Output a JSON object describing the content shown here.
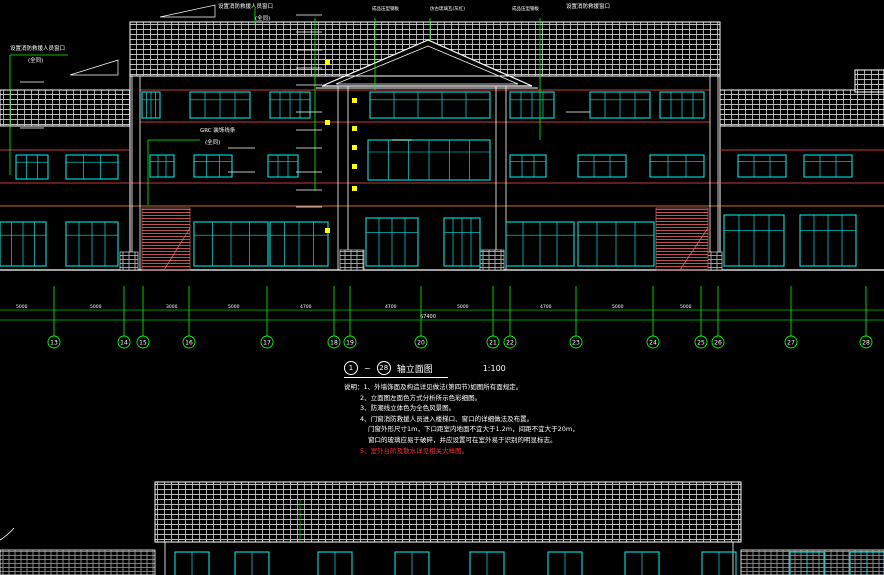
{
  "drawing": {
    "title_circle_from": "1",
    "title_circle_to": "28",
    "title_text": "轴立面图",
    "scale": "1:100",
    "notes": [
      "说明：1、外墙饰面及构造详见做法(第四节)如图所有面规定。",
      "2、立面图左面色方式分析所示色彩细图。",
      "3、防潮线立体色为全色风景图。",
      "4、门窗消防救援人员进入楼梯口、窗口的详细做法及布置。",
      "门窗外形尺寸1m，下口距室内地面不宜大于1.2m，间距不宜大于20m，",
      "窗口的玻璃应易于破碎，并应设置可在室外易于识别的明显标志。",
      "5、室外台阶及散水详见相关大样图。"
    ],
    "top_labels": {
      "fire_window_a": "设置消防救援人员窗口",
      "fire_window_b": "设置消防救援人员窗口",
      "fire_window_c": "设置消防救援窗口",
      "all": "(全同)",
      "accent_line": "GRC 装饰线条",
      "sheet_a": "成品压型钢板",
      "sheet_b": "仿古琉璃瓦(灰红)",
      "sheet_c": "成品压型钢板"
    },
    "axes": [
      "13",
      "14",
      "15",
      "16",
      "17",
      "18",
      "19",
      "20",
      "21",
      "22",
      "23",
      "24",
      "25",
      "26",
      "27",
      "28"
    ],
    "dimensions": [
      "5000",
      "5000",
      "3000",
      "5000",
      "4700",
      "4700",
      "5000",
      "4700",
      "5000",
      "5000"
    ],
    "total_dim": "67400",
    "colors": {
      "background": "#000000",
      "roof_tile": "#d8d8d8",
      "window_frame": "#00e5e5",
      "axis_green": "#00ff00",
      "dim_green": "#00c800",
      "pink_red": "#ff5050",
      "yellow": "#ffff00",
      "note_red": "#ff3030"
    }
  }
}
